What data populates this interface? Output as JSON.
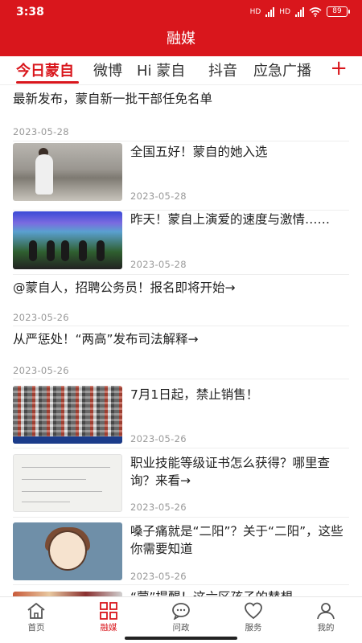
{
  "status_bar": {
    "time": "3:38",
    "network1": "HD",
    "network2": "HD",
    "battery": "89"
  },
  "header": {
    "title": "融媒"
  },
  "tabs": [
    {
      "label": "今日蒙自",
      "active": true
    },
    {
      "label": "微博"
    },
    {
      "label": "Hi 蒙自"
    },
    {
      "label": "抖音"
    },
    {
      "label": "应急广播"
    }
  ],
  "tab_add": "+",
  "feed": [
    {
      "title": "最新发布，蒙自新一批干部任免名单",
      "date": "2023-05-28"
    },
    {
      "title": "全国五好！蒙自的她入选",
      "date": "2023-05-28"
    },
    {
      "title": "昨天！蒙自上演爱的速度与激情……",
      "date": "2023-05-28"
    },
    {
      "title": "@蒙自人，招聘公务员！报名即将开始→",
      "date": "2023-05-26"
    },
    {
      "title": "从严惩处！“两高”发布司法解释→",
      "date": "2023-05-26"
    },
    {
      "title": "7月1日起，禁止销售！",
      "date": "2023-05-26"
    },
    {
      "title": "职业技能等级证书怎么获得？哪里查询？来看→",
      "date": "2023-05-26"
    },
    {
      "title": "嗓子痛就是“二阳”？关于“二阳”，这些你需要知道",
      "date": "2023-05-26"
    },
    {
      "title": "“蒙”提醒！这六区孩子的替想"
    }
  ],
  "bottom_nav": [
    {
      "label": "首页",
      "icon": "home-icon"
    },
    {
      "label": "融媒",
      "icon": "grid-icon",
      "active": true
    },
    {
      "label": "问政",
      "icon": "chat-icon"
    },
    {
      "label": "服务",
      "icon": "heart-icon"
    },
    {
      "label": "我的",
      "icon": "user-icon"
    }
  ],
  "colors": {
    "brand": "#d9161c",
    "date": "#999999"
  }
}
